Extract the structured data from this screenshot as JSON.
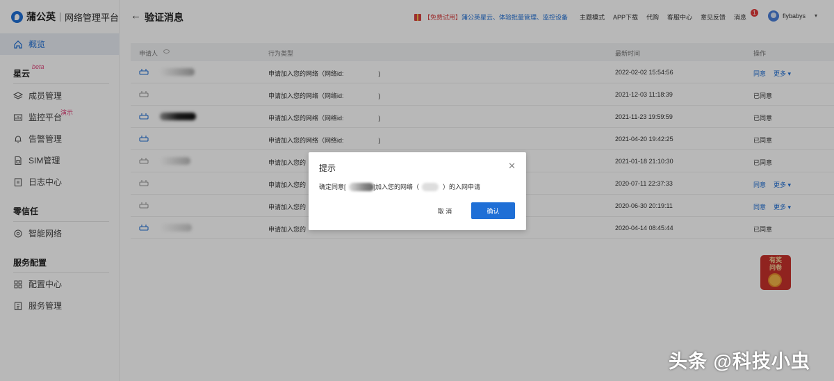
{
  "brand": {
    "name": "蒲公英",
    "subtitle": "网络管理平台"
  },
  "header": {
    "page_title": "验证消息",
    "promo": {
      "free_tag": "【免费试用】",
      "text": "蒲公英星云、体验批量管理、监控设备"
    },
    "links": [
      "主题模式",
      "APP下载",
      "代购",
      "客服中心",
      "意见反馈",
      "消息"
    ],
    "message_badge": "1",
    "username": "flybabys"
  },
  "sidebar": {
    "overview": "概览",
    "sections": [
      {
        "title": "星云",
        "tag": "beta",
        "items": [
          {
            "label": "成员管理",
            "icon": "layers-icon"
          },
          {
            "label": "监控平台",
            "icon": "monitor-icon",
            "tag": "演示"
          },
          {
            "label": "告警管理",
            "icon": "bell-icon"
          },
          {
            "label": "SIM管理",
            "icon": "sim-card-icon"
          },
          {
            "label": "日志中心",
            "icon": "log-icon"
          }
        ]
      },
      {
        "title": "零信任",
        "items": [
          {
            "label": "智能网络",
            "icon": "network-icon"
          }
        ]
      },
      {
        "title": "服务配置",
        "items": [
          {
            "label": "配置中心",
            "icon": "grid-icon"
          },
          {
            "label": "服务管理",
            "icon": "list-icon"
          }
        ]
      }
    ]
  },
  "table": {
    "columns": [
      "申请人",
      "行为类型",
      "最新时间",
      "操作"
    ],
    "rows": [
      {
        "behavior": "申请加入您的网络（网络id:",
        "behavior_end": ")",
        "time": "2022-02-02 15:54:56",
        "status": "",
        "agree": "同意",
        "more": "更多"
      },
      {
        "behavior": "申请加入您的网络（网络id:",
        "behavior_end": ")",
        "time": "2021-12-03 11:18:39",
        "status": "已同意",
        "agree": "",
        "more": ""
      },
      {
        "behavior": "申请加入您的网络（网络id:",
        "behavior_end": ")",
        "time": "2021-11-23 19:59:59",
        "status": "已同意",
        "agree": "",
        "more": ""
      },
      {
        "behavior": "申请加入您的网络（网络id:",
        "behavior_end": ")",
        "time": "2021-04-20 19:42:25",
        "status": "已同意",
        "agree": "",
        "more": ""
      },
      {
        "behavior": "申请加入您的",
        "behavior_end": "",
        "time": "2021-01-18 21:10:30",
        "status": "已同意",
        "agree": "",
        "more": ""
      },
      {
        "behavior": "申请加入您的",
        "behavior_end": "",
        "time": "2020-07-11 22:37:33",
        "status": "",
        "agree": "同意",
        "more": "更多"
      },
      {
        "behavior": "申请加入您的",
        "behavior_end": "",
        "time": "2020-06-30 20:19:11",
        "status": "",
        "agree": "同意",
        "more": "更多"
      },
      {
        "behavior": "申请加入您的",
        "behavior_end": "",
        "time": "2020-04-14 08:45:44",
        "status": "已同意",
        "agree": "",
        "more": ""
      }
    ]
  },
  "dialog": {
    "title": "提示",
    "message_prefix": "确定同意[",
    "message_middle": "]加入您的网络（",
    "message_suffix": "）的入网申请",
    "cancel_label": "取 消",
    "confirm_label": "确认"
  },
  "survey": {
    "line1": "有奖",
    "line2": "问卷"
  },
  "watermark": "头条 @科技小虫"
}
